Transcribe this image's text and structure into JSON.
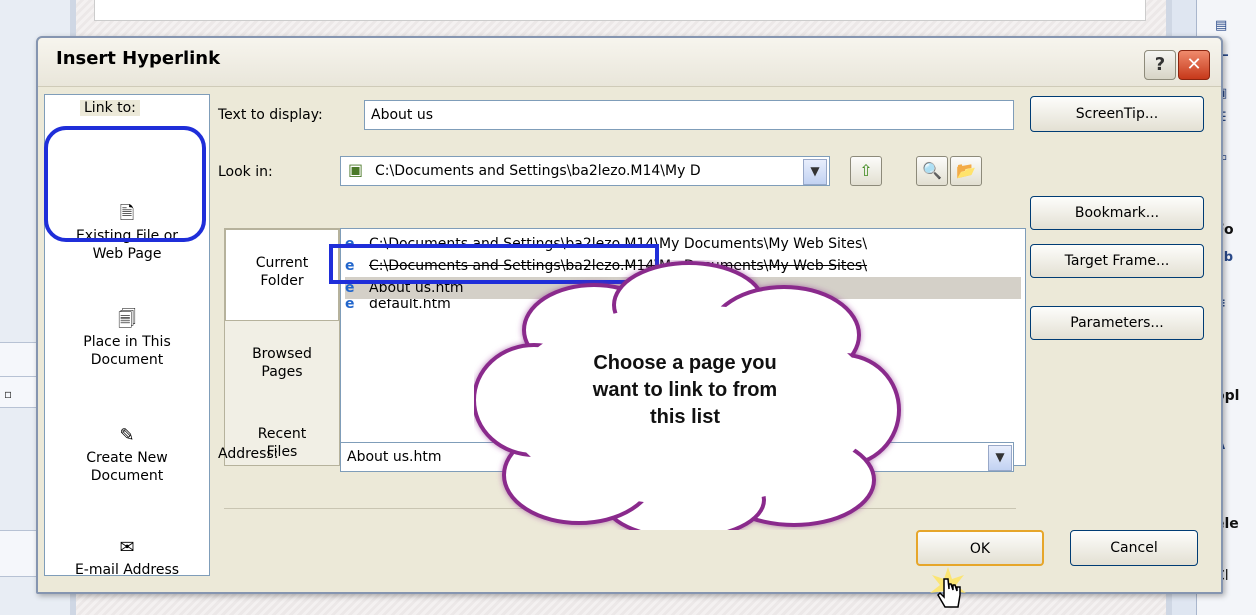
{
  "dialog": {
    "title": "Insert Hyperlink",
    "help_symbol": "?",
    "close_symbol": "✕"
  },
  "link_to": {
    "label": "Link to:",
    "items": [
      {
        "label_line1": "Existing File or",
        "label_line2": "Web Page",
        "icon": "existing-file-icon",
        "selected": true
      },
      {
        "label_line1": "Place in This",
        "label_line2": "Document",
        "icon": "place-in-document-icon",
        "selected": false
      },
      {
        "label_line1": "Create New",
        "label_line2": "Document",
        "icon": "create-new-document-icon",
        "selected": false
      },
      {
        "label_line1": "E-mail Address",
        "label_line2": "",
        "icon": "email-address-icon",
        "selected": false
      }
    ]
  },
  "text_to_display": {
    "label": "Text to display:",
    "value": "About us"
  },
  "look_in": {
    "label": "Look in:",
    "value": "C:\\Documents and Settings\\ba2lezo.M14\\My D"
  },
  "places": [
    {
      "line1": "Current",
      "line2": "Folder",
      "selected": true
    },
    {
      "line1": "Browsed",
      "line2": "Pages",
      "selected": false
    },
    {
      "line1": "Recent",
      "line2": "Files",
      "selected": false
    }
  ],
  "files": [
    {
      "name": "C:\\Documents and Settings\\ba2lezo.M14\\My Documents\\My Web Sites\\",
      "selected": false
    },
    {
      "name": "C:\\Documents and Settings\\ba2lezo.M14\\My Documents\\My Web Sites\\",
      "selected": false
    },
    {
      "name": "About us.htm",
      "selected": true
    },
    {
      "name": "default.htm",
      "selected": false
    }
  ],
  "address": {
    "label": "Address:",
    "value": "About us.htm"
  },
  "side_buttons": {
    "screentip": "ScreenTip...",
    "bookmark": "Bookmark...",
    "target_frame": "Target Frame...",
    "parameters": "Parameters..."
  },
  "footer_buttons": {
    "ok": "OK",
    "cancel": "Cancel"
  },
  "callout": {
    "line1": "Choose a page you",
    "line2": "want to link to from",
    "line3": "this list"
  },
  "background_app": {
    "right_pane_texts": [
      "Fo",
      "opl",
      "ele",
      "Cl"
    ]
  },
  "colors": {
    "annotation_blue": "#1f2ed9",
    "cloud_fill": "#ffffff",
    "cloud_border": "#8a2a8c",
    "selection_gray": "#d4d0c8"
  }
}
